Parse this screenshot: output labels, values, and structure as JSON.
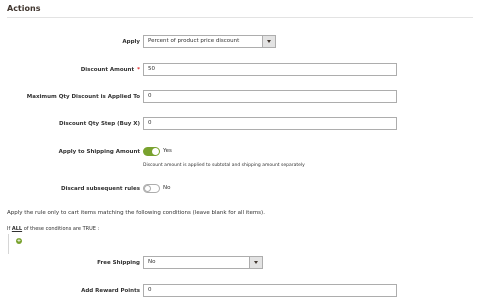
{
  "section": {
    "title": "Actions"
  },
  "apply": {
    "label": "Apply",
    "value": "Percent of product price discount"
  },
  "discount_amount": {
    "label": "Discount Amount",
    "required_mark": "*",
    "value": "50"
  },
  "max_qty": {
    "label": "Maximum Qty Discount is Applied To",
    "value": "0"
  },
  "qty_step": {
    "label": "Discount Qty Step (Buy X)",
    "value": "0"
  },
  "apply_shipping": {
    "label": "Apply to Shipping Amount",
    "state": "Yes",
    "note": "Discount amount is applied to subtotal and shipping amount separately"
  },
  "discard_rules": {
    "label": "Discard subsequent rules",
    "state": "No"
  },
  "conditions": {
    "intro": "Apply the rule only to cart items matching the following conditions (leave blank for all items).",
    "prefix": "If",
    "aggregator": "ALL",
    "middle": "of these conditions are",
    "value": "TRUE",
    "suffix": ":"
  },
  "free_shipping": {
    "label": "Free Shipping",
    "value": "No"
  },
  "reward_points": {
    "label": "Add Reward Points",
    "value": "0"
  },
  "colors": {
    "accent_green": "#79a22e",
    "required_red": "#e22626",
    "border": "#adadad"
  }
}
